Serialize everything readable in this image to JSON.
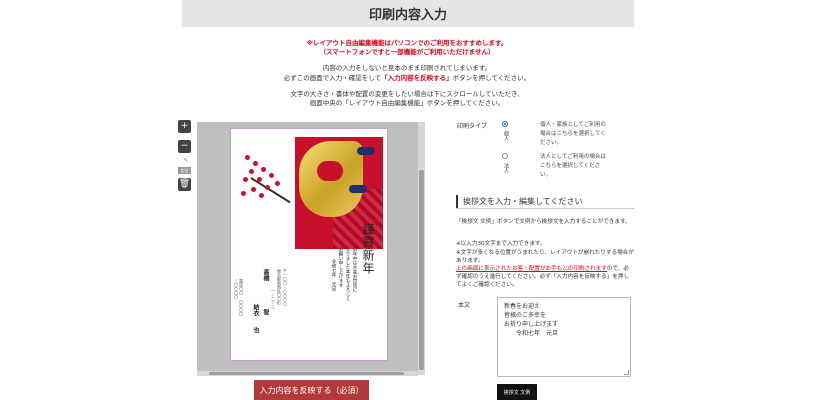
{
  "title": "印刷内容入力",
  "notices": {
    "red_line1": "※レイアウト自由編集機能はパソコンでのご利用をおすすめします。",
    "red_line2": "（スマートフォンですと一部機能がご利用いただけません）",
    "line3": "内容の入力をしないと見本のまま印刷されてしまいます。",
    "line4_pre": "必ずこの画面で入力・確認をして",
    "line4_red": "「入力内容を反映する」",
    "line4_post": "ボタンを押してください。",
    "line5": "文字の大きさ・書体や配置の変更をしたい場合は下にスクロールしていただき、",
    "line6": "画面中央の「レイアウト自由編集機能」ボタンを押してください。"
  },
  "tools": {
    "zoom_in": "+",
    "zoom_out": "−",
    "sep": "↖",
    "small": "定位",
    "delete": "🗑"
  },
  "card": {
    "greeting_big": "謹賀新年",
    "greeting_line1": "旧年中は大変お世話に",
    "greeting_line2": "なりました本年もよろしく",
    "greeting_line3": "お願い申し上げます",
    "greeting_date": "令和七年 元旦",
    "address_line1": "〒一〇〇-〇〇〇〇",
    "address_line2": "東京都新宿区〇〇町",
    "address_line3": "一ー二ー三",
    "name1": "高橋",
    "name2": "智",
    "name3": "結衣",
    "name4": "也",
    "side_line1": "電話〇〇-〇〇〇〇",
    "side_line2": "ー〇〇〇〇"
  },
  "print_type": {
    "label": "印刷タイプ",
    "option1_title": "個人",
    "option1_desc": "個人・家族としてご利用の場合はこちらを選択してください。",
    "option2_title": "法人",
    "option2_desc": "法人としてご利用の場合はこちらを選択してください。"
  },
  "section": {
    "heading": "挨拶文を入力・編集してください",
    "info1": "「挨拶文 文例」ボタンで文例から挨拶文を入力することができます。",
    "info2": "※以入力30文字まで入力できます。",
    "info3": "※文字が多くなる位置がうまれたり、レイアウトが崩れたりする場合があります。",
    "info4_red": "上の画面に表示されたお客・配置がお手もとの印刷されます",
    "info4_post": "ので、必ず確認のうえ進行してください。必ず「入力内容を反映する」を押してよくご確認ください。"
  },
  "text_field": {
    "label": "本文",
    "value": "新春をお迎え\n皆様のご多幸を\nお祈り申し上げます\n　　令和七年　元旦"
  },
  "buttons": {
    "sample_text": "挨拶文 文例",
    "submit": "入力内容を反映する（必須）"
  },
  "colors": {
    "accent_red": "#e0001b",
    "submit_bg": "#b23a3a",
    "radio_blue": "#1a5fc9"
  }
}
